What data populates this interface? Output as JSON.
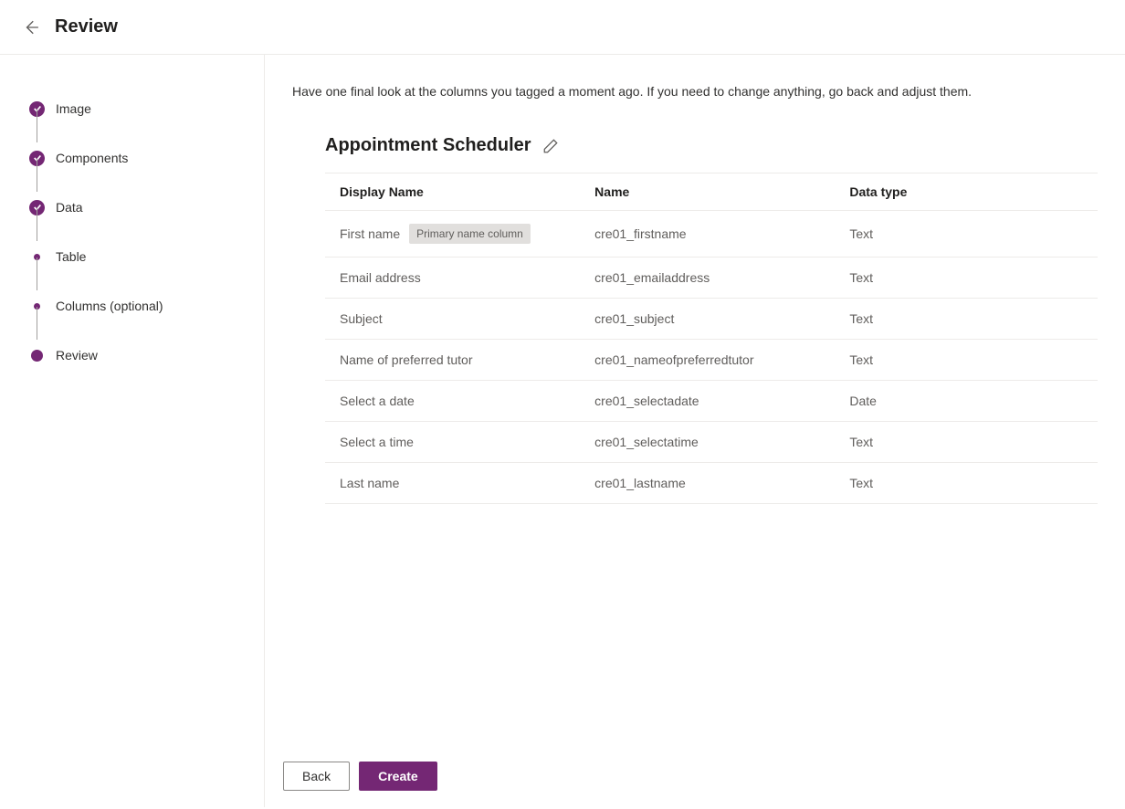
{
  "header": {
    "title": "Review"
  },
  "steps": [
    {
      "label": "Image",
      "state": "completed"
    },
    {
      "label": "Components",
      "state": "completed"
    },
    {
      "label": "Data",
      "state": "completed"
    },
    {
      "label": "Table",
      "state": "dot"
    },
    {
      "label": "Columns (optional)",
      "state": "dot"
    },
    {
      "label": "Review",
      "state": "current"
    }
  ],
  "intro": "Have one final look at the columns you tagged a moment ago. If you need to change anything, go back and adjust them.",
  "entity": {
    "name": "Appointment Scheduler"
  },
  "table": {
    "headers": {
      "displayName": "Display Name",
      "name": "Name",
      "dataType": "Data type"
    },
    "primaryBadge": "Primary name column",
    "rows": [
      {
        "displayName": "First name",
        "isPrimary": true,
        "name": "cre01_firstname",
        "dataType": "Text"
      },
      {
        "displayName": "Email address",
        "isPrimary": false,
        "name": "cre01_emailaddress",
        "dataType": "Text"
      },
      {
        "displayName": "Subject",
        "isPrimary": false,
        "name": "cre01_subject",
        "dataType": "Text"
      },
      {
        "displayName": "Name of preferred tutor",
        "isPrimary": false,
        "name": "cre01_nameofpreferredtutor",
        "dataType": "Text"
      },
      {
        "displayName": "Select a date",
        "isPrimary": false,
        "name": "cre01_selectadate",
        "dataType": "Date"
      },
      {
        "displayName": "Select a time",
        "isPrimary": false,
        "name": "cre01_selectatime",
        "dataType": "Text"
      },
      {
        "displayName": "Last name",
        "isPrimary": false,
        "name": "cre01_lastname",
        "dataType": "Text"
      }
    ]
  },
  "footer": {
    "back": "Back",
    "create": "Create"
  }
}
